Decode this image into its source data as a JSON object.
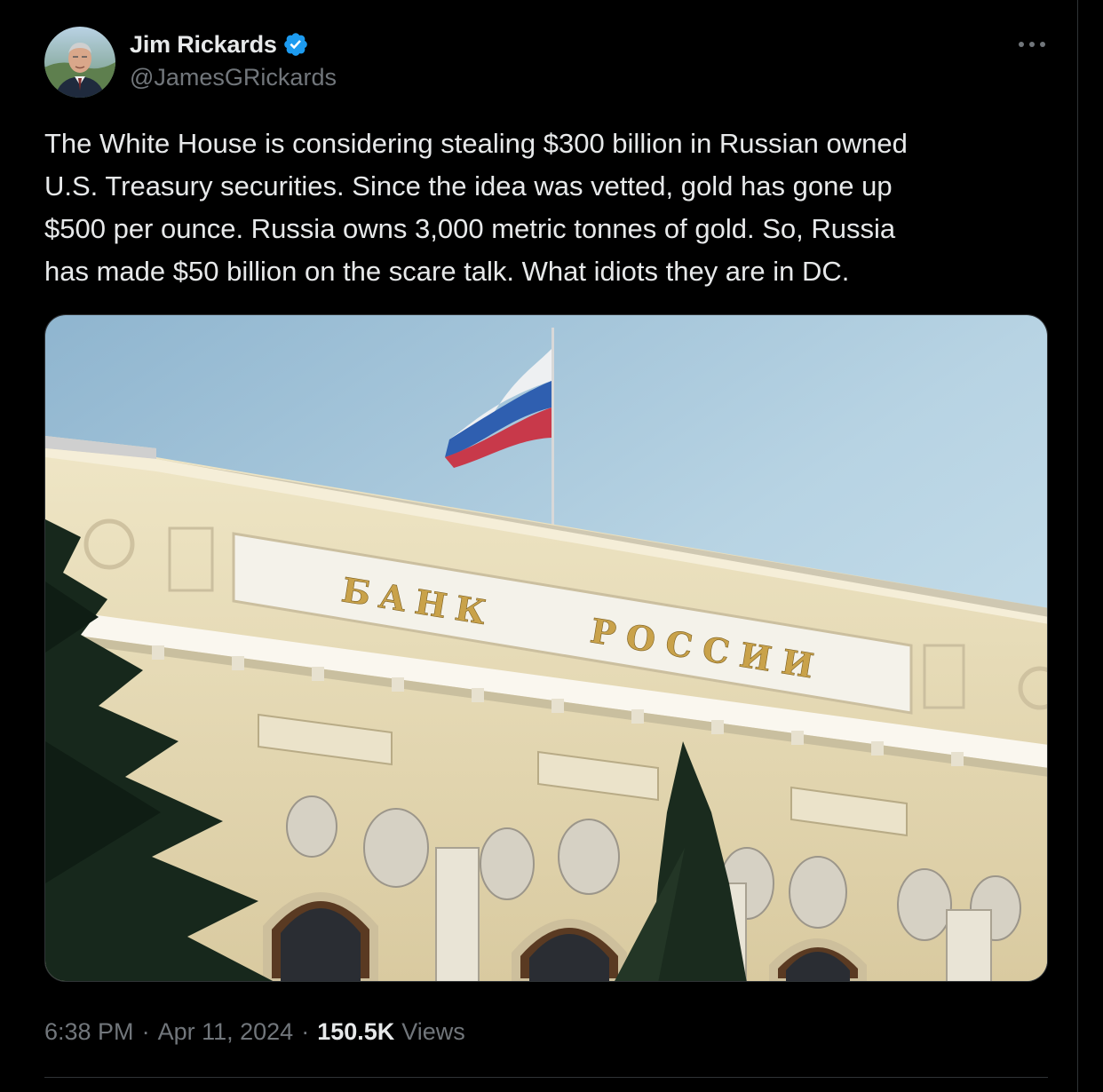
{
  "tweet": {
    "author": {
      "display_name": "Jim Rickards",
      "handle": "@JamesGRickards",
      "verified": true,
      "avatar_icon": "profile-photo",
      "verified_icon": "verified-badge-icon"
    },
    "more_icon": "more-options-icon",
    "text": "The White House is considering stealing $300 billion in Russian owned\nU.S. Treasury securities. Since the idea was vetted, gold has gone up\n$500 per ounce. Russia owns 3,000 metric tonnes of gold. So, Russia\nhas made $50 billion on the scare talk. What idiots they are in DC.",
    "media": {
      "sign_word_1": "БАНК",
      "sign_word_2": "РОССИИ"
    },
    "time": "6:38 PM",
    "date": "Apr 11, 2024",
    "separator": "·",
    "views_count": "150.5K",
    "views_label": "Views"
  },
  "colors": {
    "background": "#000000",
    "text_primary": "#e7e9ea",
    "text_secondary": "#71767b",
    "border": "#2f3336",
    "verified_blue": "#1d9bf0"
  }
}
